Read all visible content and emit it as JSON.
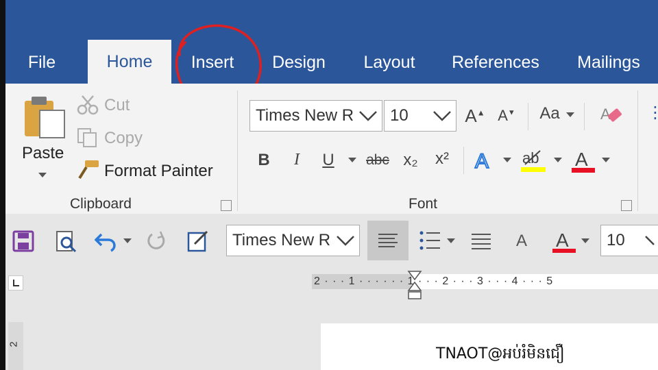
{
  "tabs": [
    {
      "label": "File"
    },
    {
      "label": "Home"
    },
    {
      "label": "Insert"
    },
    {
      "label": "Design"
    },
    {
      "label": "Layout"
    },
    {
      "label": "References"
    },
    {
      "label": "Mailings"
    }
  ],
  "active_tab": "Home",
  "highlighted_tab": "Insert",
  "clipboard": {
    "paste_label": "Paste",
    "cut_label": "Cut",
    "copy_label": "Copy",
    "format_painter_label": "Format Painter",
    "group_label": "Clipboard"
  },
  "font": {
    "font_name": "Times New R",
    "font_size": "10",
    "change_case_label": "Aa",
    "bold": "B",
    "italic": "I",
    "underline": "U",
    "strikethrough": "abc",
    "subscript": "x₂",
    "superscript": "x²",
    "font_color_letter": "A",
    "group_label": "Font"
  },
  "qat": {
    "font_name": "Times New R",
    "font_size": "10",
    "font_color_letter": "A",
    "style_letter": "A"
  },
  "ruler": {
    "marks": "2 · · · 1 · · ·   · · · 1 · · · 2 · · · 3 · · · 4 · · · 5"
  },
  "vertical_ruler": {
    "mark": "2"
  },
  "watermark": {
    "text": "TNAOT@អប់រំមិនជឿ"
  },
  "colors": {
    "tab_bar": "#2b579a",
    "active_tab_text": "#2b579a",
    "annotation_circle": "#e02020",
    "font_color_bar": "#e81123",
    "highlight_bar": "#ffff00"
  }
}
